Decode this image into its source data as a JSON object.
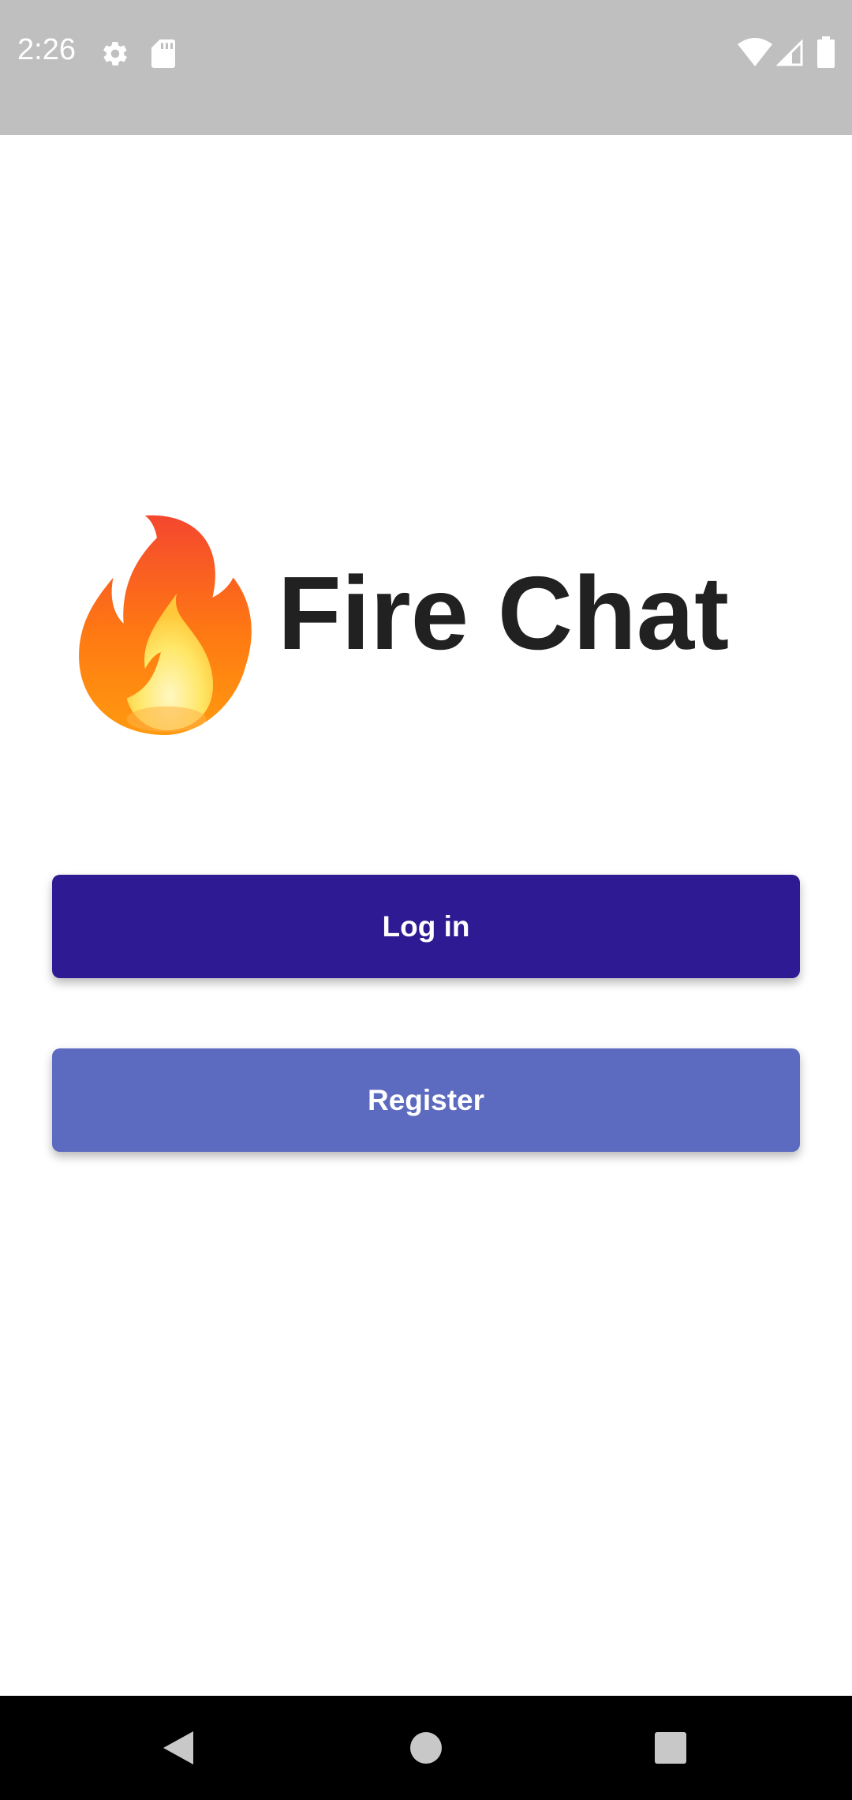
{
  "status_bar": {
    "time": "2:26",
    "icons": [
      "settings-gear-icon",
      "sd-card-icon",
      "wifi-icon",
      "cell-signal-icon",
      "battery-icon"
    ],
    "background": "#bfbfbf"
  },
  "app": {
    "logo_icon": "fire-emoji-icon",
    "title": "Fire Chat"
  },
  "actions": {
    "login_label": "Log in",
    "register_label": "Register"
  },
  "colors": {
    "login_button": "#2e1a93",
    "register_button": "#5c6bc0",
    "title_text": "#212121"
  },
  "nav_bar": {
    "icons": [
      "back-triangle-icon",
      "home-circle-icon",
      "recents-square-icon"
    ]
  }
}
